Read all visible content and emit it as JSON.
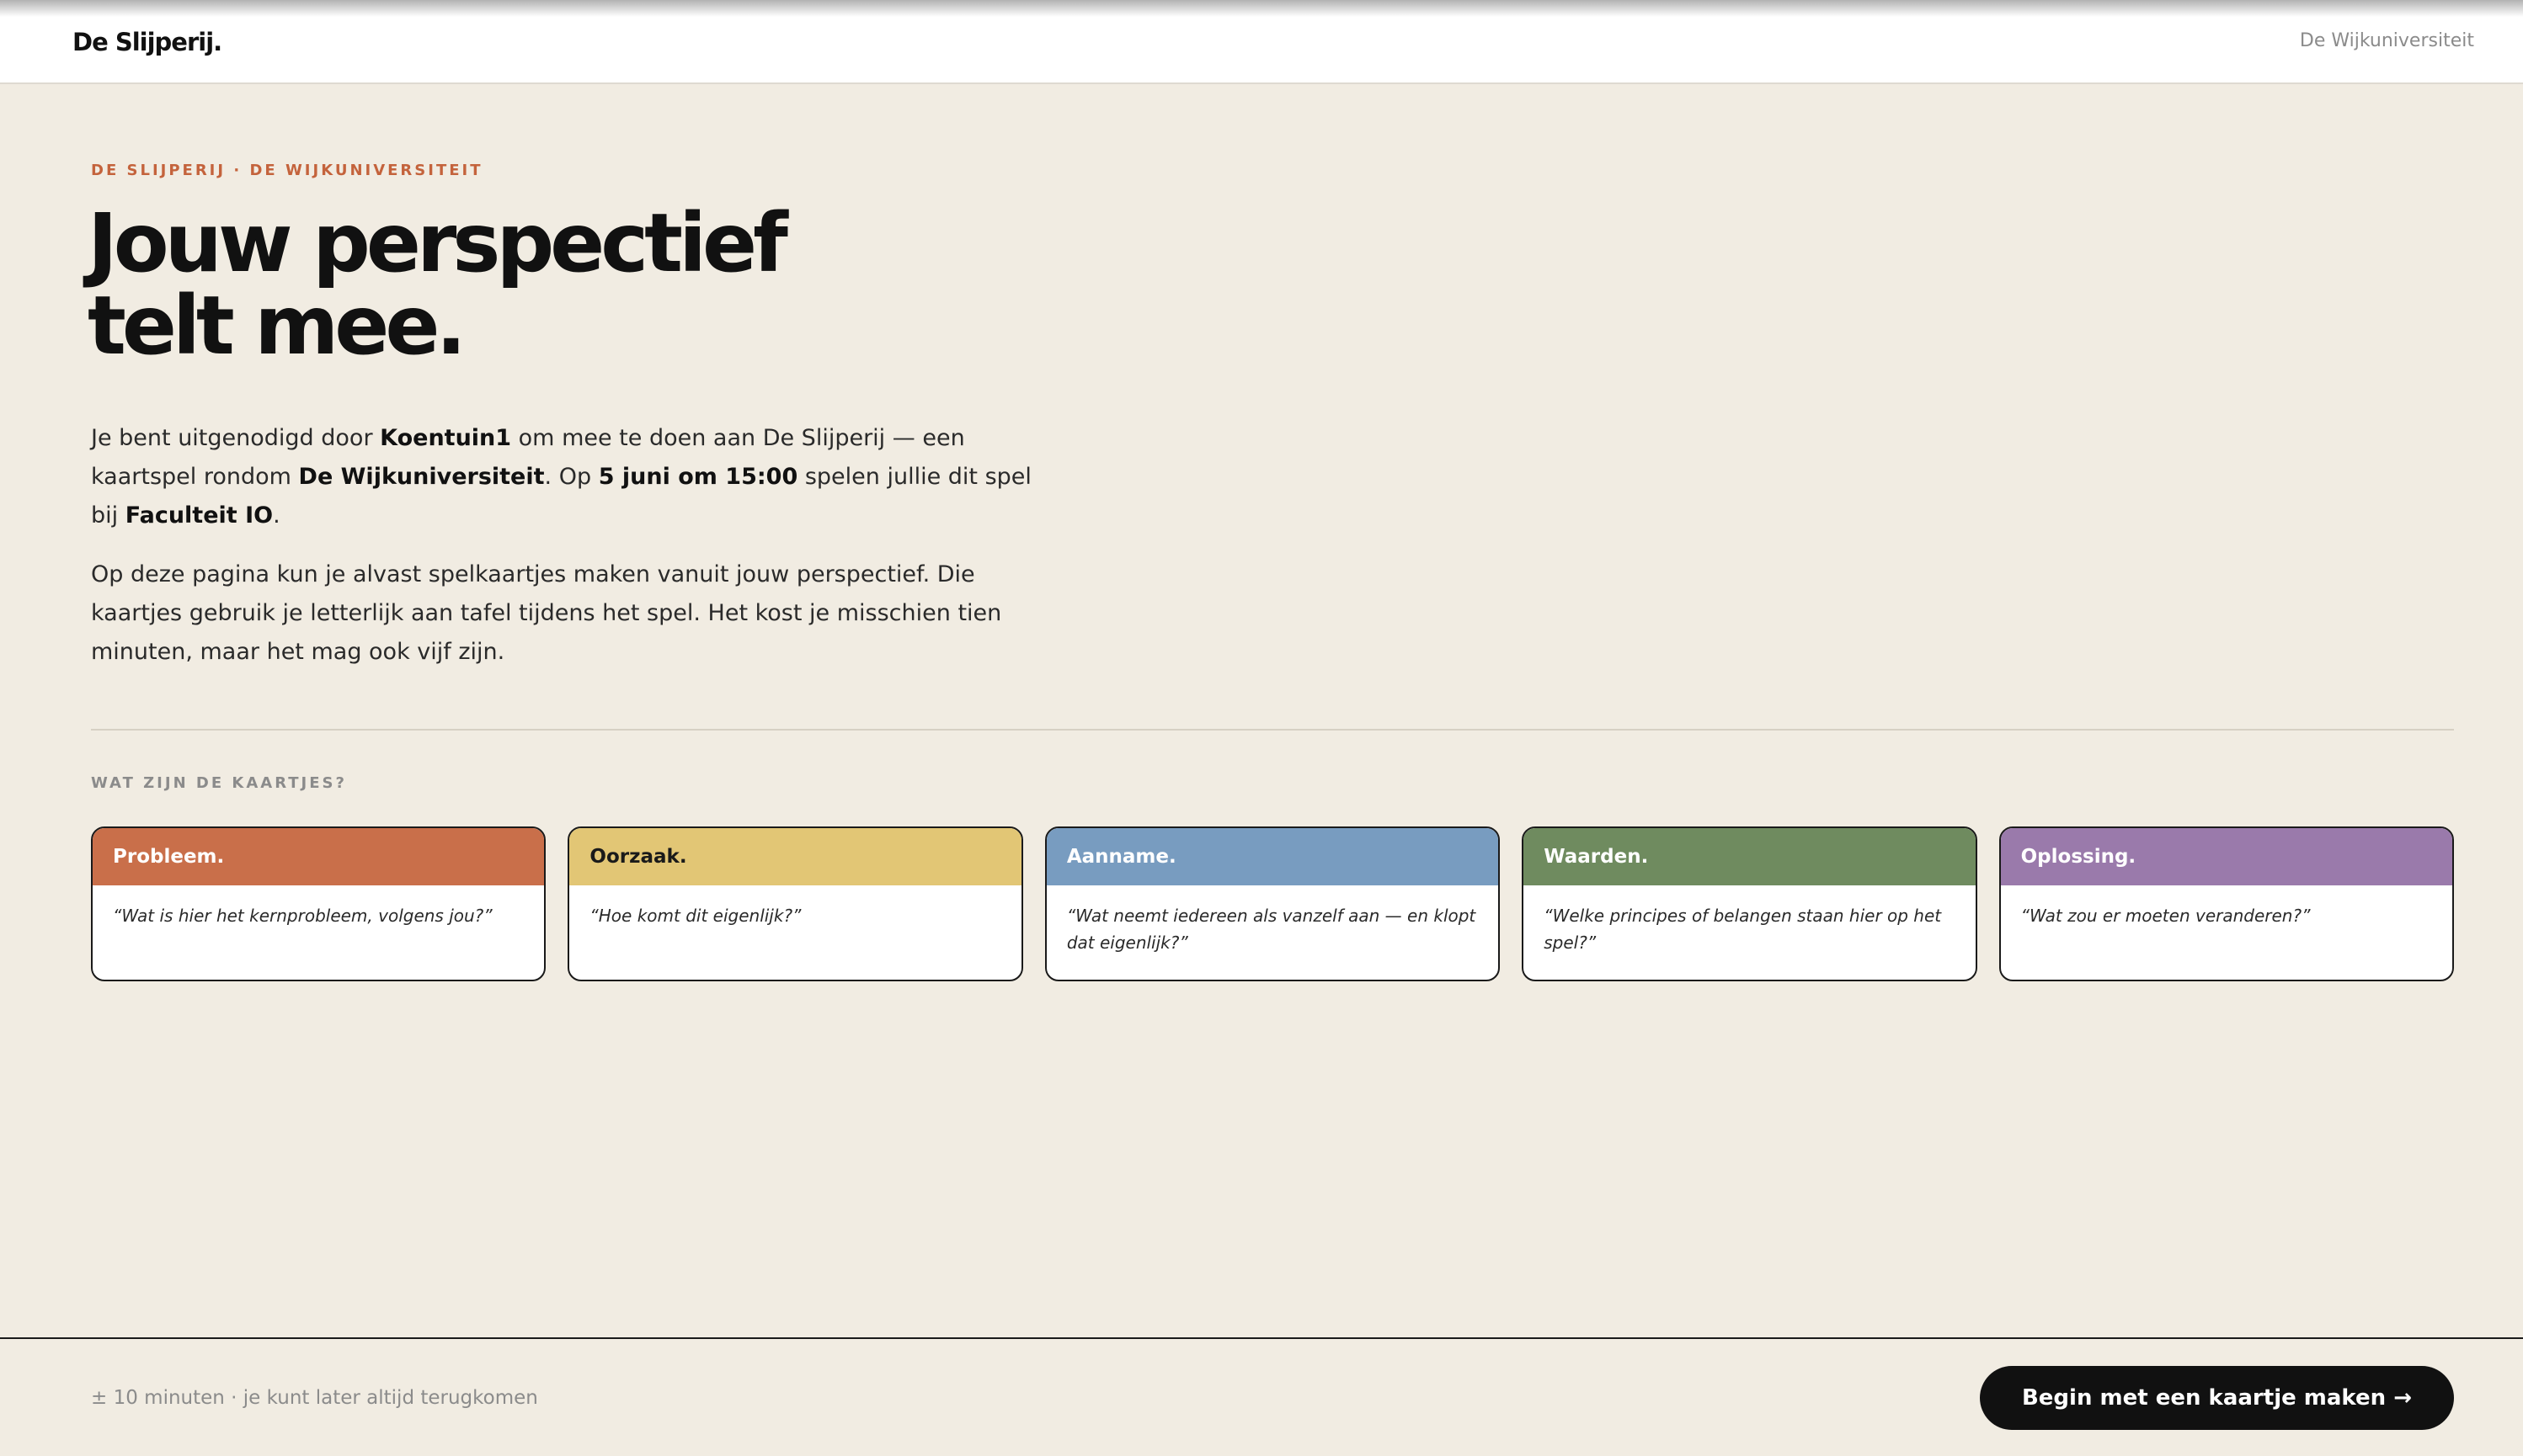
{
  "header": {
    "logo": "De Slijperij.",
    "right_link": "De Wijkuniversiteit"
  },
  "intro": {
    "eyebrow": "DE SLIJPERIJ · DE WIJKUNIVERSITEIT",
    "headline_line1": "Jouw perspectief",
    "headline_line2": "telt mee.",
    "p1": {
      "t1": "Je bent uitgenodigd door ",
      "inviter": "Koentuin1",
      "t2": " om mee te doen aan De Slijperij — een kaartspel rondom ",
      "topic": "De Wijkuniversiteit",
      "t3": ". Op ",
      "when": "5 juni om 15:00",
      "t4": " spelen jullie dit spel bij ",
      "where": "Faculteit IO",
      "t5": "."
    },
    "p2": "Op deze pagina kun je alvast spelkaartjes maken vanuit jouw perspectief. Die kaartjes gebruik je letterlijk aan tafel tijdens het spel. Het kost je misschien tien minuten, maar het mag ook vijf zijn."
  },
  "cards_section": {
    "label": "WAT ZIJN DE KAARTJES?",
    "cards": [
      {
        "title": "Probleem.",
        "question": "“Wat is hier het kernprobleem, volgens jou?”",
        "color": "#c96f4a",
        "dark_text": false
      },
      {
        "title": "Oorzaak.",
        "question": "“Hoe komt dit eigenlijk?”",
        "color": "#e2c675",
        "dark_text": true
      },
      {
        "title": "Aanname.",
        "question": "“Wat neemt iedereen als vanzelf aan — en klopt dat eigenlijk?”",
        "color": "#789cc0",
        "dark_text": false
      },
      {
        "title": "Waarden.",
        "question": "“Welke principes of belangen staan hier op het spel?”",
        "color": "#6f8b5f",
        "dark_text": false
      },
      {
        "title": "Oplossing.",
        "question": "“Wat zou er moeten veranderen?”",
        "color": "#9a7aab",
        "dark_text": false
      }
    ]
  },
  "footer": {
    "note": "± 10 minuten · je kunt later altijd terugkomen",
    "cta_label": "Begin met een kaartje maken →"
  },
  "colors": {
    "page_bg": "#f1ece2",
    "accent": "#c4633c",
    "ink": "#111111"
  }
}
